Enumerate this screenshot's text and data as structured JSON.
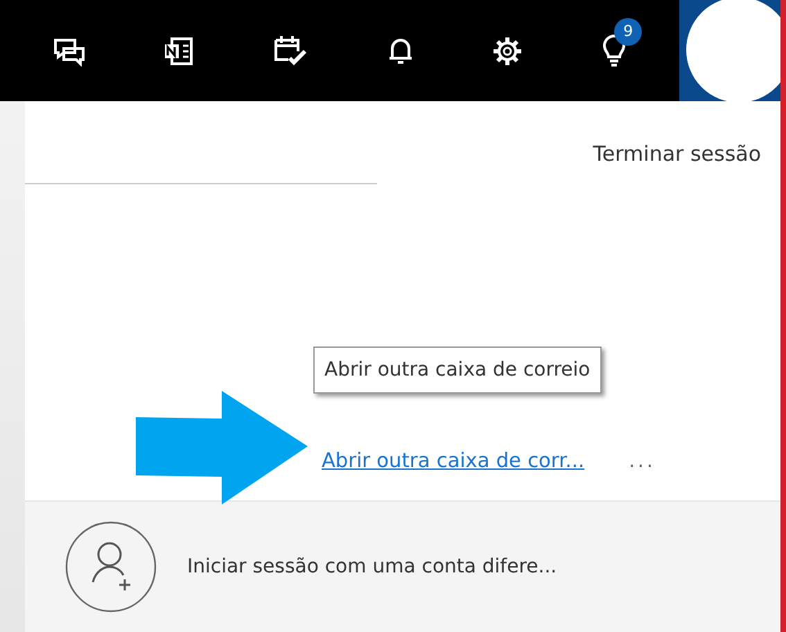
{
  "top_bar": {
    "tips_badge": "9"
  },
  "account_panel": {
    "sign_out": "Terminar sessão",
    "tooltip": "Abrir outra caixa de correio",
    "open_mailbox_link": "Abrir outra caixa de corr...",
    "more": "...",
    "sign_in_other": "Iniciar sessão com uma conta difere..."
  }
}
